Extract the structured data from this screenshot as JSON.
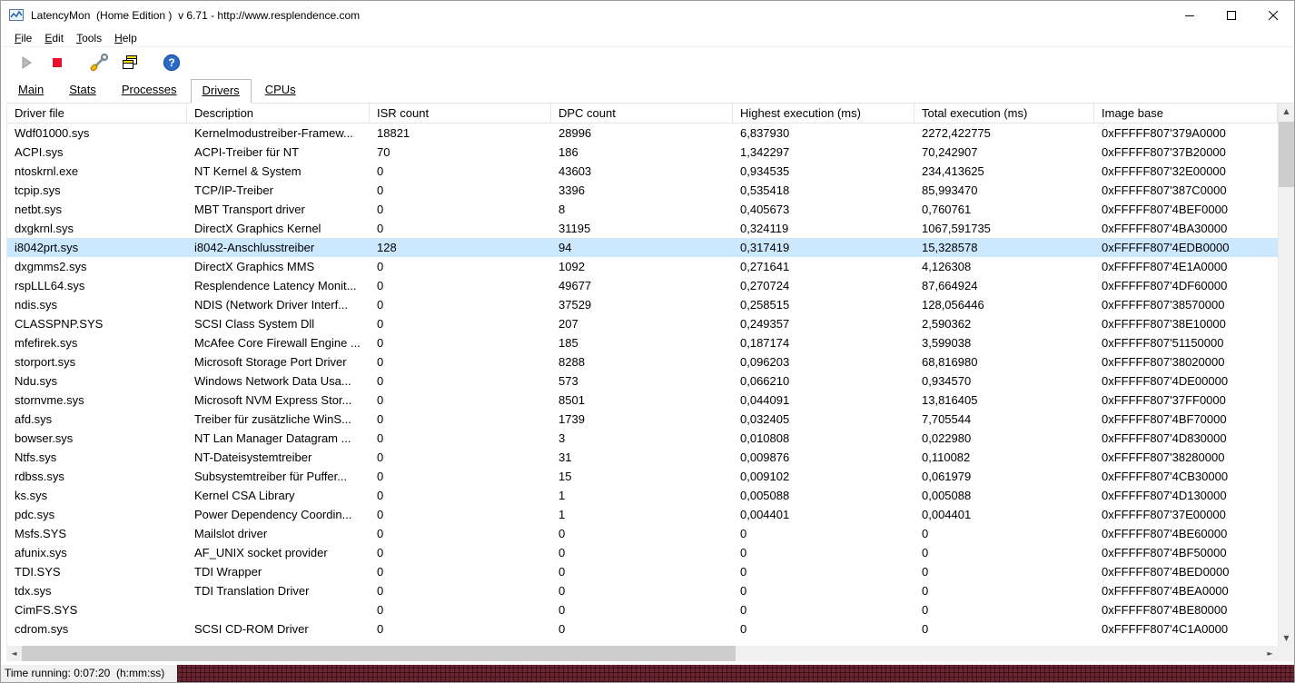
{
  "window": {
    "title": "LatencyMon  (Home Edition )  v 6.71 - http://www.resplendence.com"
  },
  "menu": {
    "items": [
      "File",
      "Edit",
      "Tools",
      "Help"
    ]
  },
  "toolbar": {
    "icons": [
      "play-icon",
      "stop-icon",
      "tools-icon",
      "copy-pages-icon",
      "help-icon"
    ]
  },
  "tabs": {
    "items": [
      {
        "label": "Main",
        "active": false
      },
      {
        "label": "Stats",
        "active": false
      },
      {
        "label": "Processes",
        "active": false
      },
      {
        "label": "Drivers",
        "active": true
      },
      {
        "label": "CPUs",
        "active": false
      }
    ]
  },
  "table": {
    "columns": [
      "Driver file",
      "Description",
      "ISR count",
      "DPC count",
      "Highest execution (ms)",
      "Total execution (ms)",
      "Image base"
    ],
    "selected_index": 6,
    "rows": [
      [
        "Wdf01000.sys",
        "Kernelmodustreiber-Framew...",
        "18821",
        "28996",
        "6,837930",
        "2272,422775",
        "0xFFFFF807'379A0000"
      ],
      [
        "ACPI.sys",
        "ACPI-Treiber für NT",
        "70",
        "186",
        "1,342297",
        "70,242907",
        "0xFFFFF807'37B20000"
      ],
      [
        "ntoskrnl.exe",
        "NT Kernel & System",
        "0",
        "43603",
        "0,934535",
        "234,413625",
        "0xFFFFF807'32E00000"
      ],
      [
        "tcpip.sys",
        "TCP/IP-Treiber",
        "0",
        "3396",
        "0,535418",
        "85,993470",
        "0xFFFFF807'387C0000"
      ],
      [
        "netbt.sys",
        "MBT Transport driver",
        "0",
        "8",
        "0,405673",
        "0,760761",
        "0xFFFFF807'4BEF0000"
      ],
      [
        "dxgkrnl.sys",
        "DirectX Graphics Kernel",
        "0",
        "31195",
        "0,324119",
        "1067,591735",
        "0xFFFFF807'4BA30000"
      ],
      [
        "i8042prt.sys",
        "i8042-Anschlusstreiber",
        "128",
        "94",
        "0,317419",
        "15,328578",
        "0xFFFFF807'4EDB0000"
      ],
      [
        "dxgmms2.sys",
        "DirectX Graphics MMS",
        "0",
        "1092",
        "0,271641",
        "4,126308",
        "0xFFFFF807'4E1A0000"
      ],
      [
        "rspLLL64.sys",
        "Resplendence Latency Monit...",
        "0",
        "49677",
        "0,270724",
        "87,664924",
        "0xFFFFF807'4DF60000"
      ],
      [
        "ndis.sys",
        "NDIS (Network Driver Interf...",
        "0",
        "37529",
        "0,258515",
        "128,056446",
        "0xFFFFF807'38570000"
      ],
      [
        "CLASSPNP.SYS",
        "SCSI Class System Dll",
        "0",
        "207",
        "0,249357",
        "2,590362",
        "0xFFFFF807'38E10000"
      ],
      [
        "mfefirek.sys",
        "McAfee Core Firewall Engine ...",
        "0",
        "185",
        "0,187174",
        "3,599038",
        "0xFFFFF807'51150000"
      ],
      [
        "storport.sys",
        "Microsoft Storage Port Driver",
        "0",
        "8288",
        "0,096203",
        "68,816980",
        "0xFFFFF807'38020000"
      ],
      [
        "Ndu.sys",
        "Windows Network Data Usa...",
        "0",
        "573",
        "0,066210",
        "0,934570",
        "0xFFFFF807'4DE00000"
      ],
      [
        "stornvme.sys",
        "Microsoft NVM Express Stor...",
        "0",
        "8501",
        "0,044091",
        "13,816405",
        "0xFFFFF807'37FF0000"
      ],
      [
        "afd.sys",
        "Treiber für zusätzliche WinS...",
        "0",
        "1739",
        "0,032405",
        "7,705544",
        "0xFFFFF807'4BF70000"
      ],
      [
        "bowser.sys",
        "NT Lan Manager Datagram ...",
        "0",
        "3",
        "0,010808",
        "0,022980",
        "0xFFFFF807'4D830000"
      ],
      [
        "Ntfs.sys",
        "NT-Dateisystemtreiber",
        "0",
        "31",
        "0,009876",
        "0,110082",
        "0xFFFFF807'38280000"
      ],
      [
        "rdbss.sys",
        "Subsystemtreiber für Puffer...",
        "0",
        "15",
        "0,009102",
        "0,061979",
        "0xFFFFF807'4CB30000"
      ],
      [
        "ks.sys",
        "Kernel CSA Library",
        "0",
        "1",
        "0,005088",
        "0,005088",
        "0xFFFFF807'4D130000"
      ],
      [
        "pdc.sys",
        "Power Dependency Coordin...",
        "0",
        "1",
        "0,004401",
        "0,004401",
        "0xFFFFF807'37E00000"
      ],
      [
        "Msfs.SYS",
        "Mailslot driver",
        "0",
        "0",
        "0",
        "0",
        "0xFFFFF807'4BE60000"
      ],
      [
        "afunix.sys",
        "AF_UNIX socket provider",
        "0",
        "0",
        "0",
        "0",
        "0xFFFFF807'4BF50000"
      ],
      [
        "TDI.SYS",
        "TDI Wrapper",
        "0",
        "0",
        "0",
        "0",
        "0xFFFFF807'4BED0000"
      ],
      [
        "tdx.sys",
        "TDI Translation Driver",
        "0",
        "0",
        "0",
        "0",
        "0xFFFFF807'4BEA0000"
      ],
      [
        "CimFS.SYS",
        "",
        "0",
        "0",
        "0",
        "0",
        "0xFFFFF807'4BE80000"
      ],
      [
        "cdrom.sys",
        "SCSI CD-ROM Driver",
        "0",
        "0",
        "0",
        "0",
        "0xFFFFF807'4C1A0000"
      ]
    ]
  },
  "statusbar": {
    "text": "Time running: 0:07:20  (h:mm:ss)"
  },
  "colors": {
    "selected_row": "#cce8ff",
    "stop_icon": "#e8112d",
    "help_icon": "#2a6bc8",
    "desktop_pattern": "#6b2430"
  }
}
